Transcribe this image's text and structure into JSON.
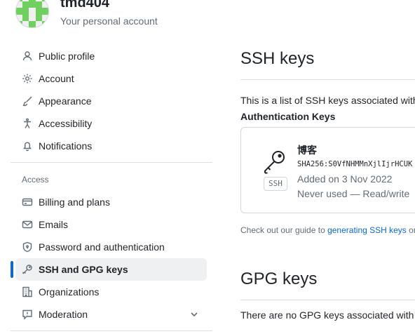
{
  "account": {
    "username": "tmd404",
    "subtitle": "Your personal account"
  },
  "sidebar": {
    "top_items": [
      {
        "label": "Public profile",
        "icon": "person-icon"
      },
      {
        "label": "Account",
        "icon": "gear-icon"
      },
      {
        "label": "Appearance",
        "icon": "paintbrush-icon"
      },
      {
        "label": "Accessibility",
        "icon": "accessibility-icon"
      },
      {
        "label": "Notifications",
        "icon": "bell-icon"
      }
    ],
    "access_label": "Access",
    "access_items": [
      {
        "label": "Billing and plans",
        "icon": "credit-card-icon"
      },
      {
        "label": "Emails",
        "icon": "mail-icon"
      },
      {
        "label": "Password and authentication",
        "icon": "shield-lock-icon"
      },
      {
        "label": "SSH and GPG keys",
        "icon": "key-icon",
        "active": true
      },
      {
        "label": "Organizations",
        "icon": "organization-icon"
      },
      {
        "label": "Moderation",
        "icon": "report-icon",
        "expandable": true
      }
    ]
  },
  "main": {
    "ssh_title": "SSH keys",
    "ssh_description": "This is a list of SSH keys associated with y",
    "auth_heading": "Authentication Keys",
    "key": {
      "title": "博客",
      "fingerprint": "SHA256:S0VfNHMMnXjlIjrHCUK",
      "added": "Added on 3 Nov 2022",
      "usage": "Never used — Read/write",
      "badge": "SSH"
    },
    "guide_prefix": "Check out our guide to ",
    "guide_link": "generating SSH keys",
    "guide_suffix": " or",
    "gpg_title": "GPG keys",
    "gpg_empty": "There are no GPG keys associated with y"
  },
  "colors": {
    "accent": "#0969da",
    "active_bg": "#eef0f2",
    "muted": "#636c76"
  }
}
